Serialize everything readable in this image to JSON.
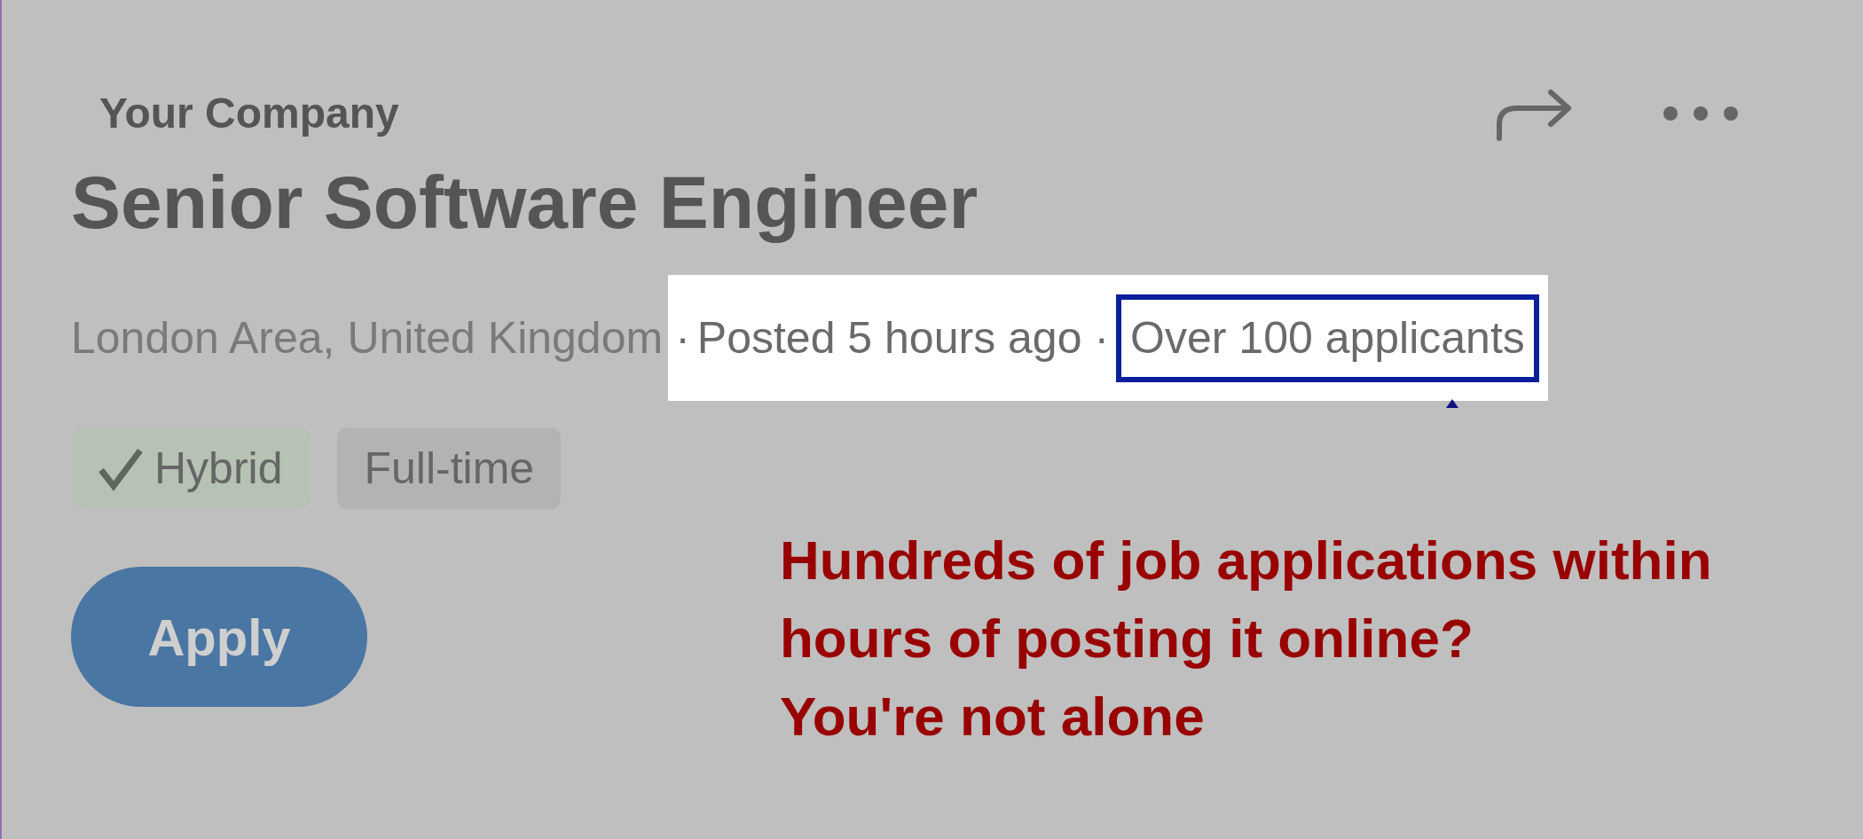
{
  "company": "Your Company",
  "job_title": "Senior Software Engineer",
  "meta": [
    {
      "text": "London Area, United Kingdom",
      "highlighted": false,
      "boxed": false
    },
    {
      "separator": "·",
      "text": "Posted 5 hours ago",
      "highlighted": true,
      "boxed": false
    },
    {
      "separator": "·",
      "text": "Over 100 applicants",
      "highlighted": true,
      "boxed": true
    }
  ],
  "tags": [
    {
      "label": "Hybrid",
      "checked": true
    },
    {
      "label": "Full-time",
      "checked": false
    }
  ],
  "apply_button": "Apply",
  "annotation": [
    "Hundreds of job applications within",
    "hours of posting it online?",
    "You're not alone"
  ]
}
